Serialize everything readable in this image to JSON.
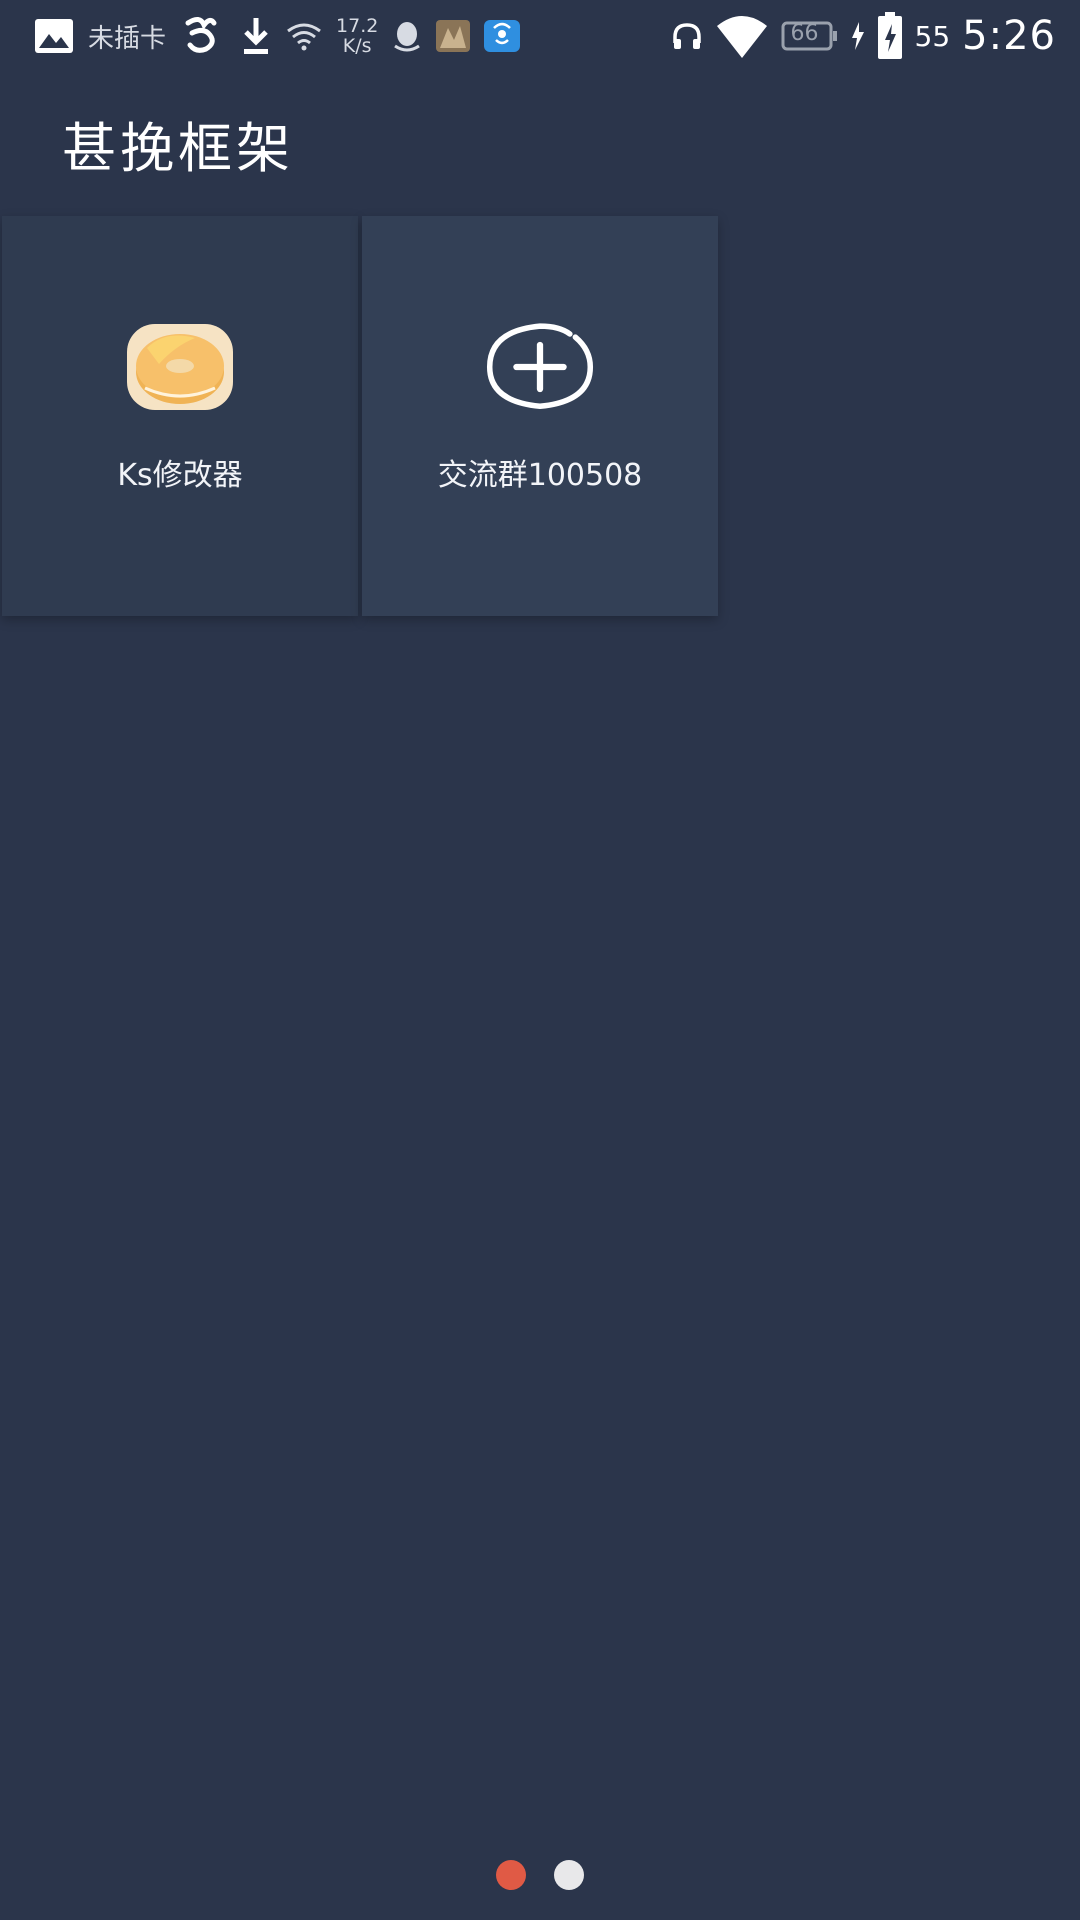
{
  "status_bar": {
    "carrier": "未插卡",
    "net_speed_value": "17.2",
    "net_speed_unit": "K/s",
    "battery_box": "66",
    "battery_percent": "55",
    "time": "5:26"
  },
  "page": {
    "title": "甚挽框架"
  },
  "apps": [
    {
      "label": "Ks修改器",
      "icon": "bagel-app-icon"
    },
    {
      "label": "交流群100508",
      "icon": "add-circle-icon"
    }
  ],
  "pager": {
    "active_color": "#e05a45",
    "inactive_color": "#e8e8ea",
    "active_index": 0,
    "count": 2
  },
  "colors": {
    "background": "#2b354b",
    "tile": "#2f3b50"
  }
}
